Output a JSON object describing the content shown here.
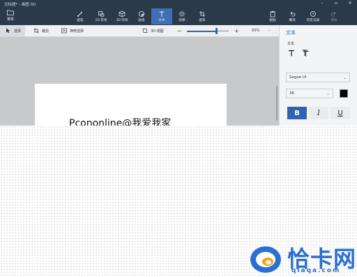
{
  "window": {
    "title": "无标题* - 画图 3D"
  },
  "ribbon": {
    "menu_label": "菜单",
    "tools": [
      {
        "label": "画笔",
        "icon": "brush-icon"
      },
      {
        "label": "2D 形状",
        "icon": "shapes-2d-icon"
      },
      {
        "label": "3D 形状",
        "icon": "shapes-3d-icon"
      },
      {
        "label": "贴纸",
        "icon": "stickers-icon"
      },
      {
        "label": "文本",
        "icon": "text-icon"
      },
      {
        "label": "效果",
        "icon": "effects-icon"
      },
      {
        "label": "画布",
        "icon": "canvas-icon"
      }
    ],
    "actions": [
      {
        "label": "粘贴",
        "icon": "paste-icon"
      },
      {
        "label": "撤消",
        "icon": "undo-icon"
      },
      {
        "label": "历史记录",
        "icon": "history-icon"
      },
      {
        "label": "重做",
        "icon": "redo-icon"
      }
    ],
    "active_color": "#3f6fb4"
  },
  "subbar": {
    "select_label": "选择",
    "crop_label": "裁剪",
    "magic_select_label": "神奇选择",
    "view3d_label": "3D 视图",
    "zoom_minus": "−",
    "zoom_plus": "+",
    "zoom_value": "93%",
    "zoom_level": 0.7,
    "more": "···"
  },
  "canvas": {
    "text": "Pcononline@我爱我家"
  },
  "panel": {
    "title": "文本",
    "subtitle": "文本",
    "font_family": "Segoe UI",
    "font_size": "36",
    "text_color": "#000000",
    "bold": "B",
    "italic": "I",
    "underline": "U"
  },
  "watermark": {
    "name": "恰卡网",
    "url": "qiaqa.com",
    "color": "#2a6fd1"
  }
}
